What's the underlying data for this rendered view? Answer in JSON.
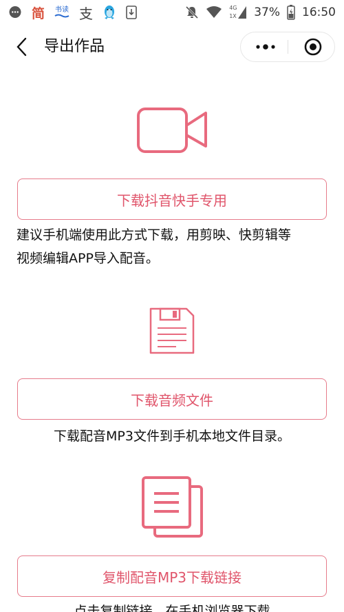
{
  "statusbar": {
    "left_icons": [
      "chat-bubble-icon",
      "jian-app-icon",
      "reader-app-icon",
      "alipay-icon",
      "qq-penguin-icon",
      "download-icon"
    ],
    "jian_glyph": "简",
    "reader_glyph": "书读",
    "alipay_glyph": "支",
    "network_label_top": "4G",
    "network_label_bottom": "1X",
    "battery": "37%",
    "time": "16:50"
  },
  "header": {
    "title": "导出作品"
  },
  "sections": [
    {
      "icon": "video-camera-icon",
      "button_label": "下载抖音快手专用",
      "description_lines": [
        "建议手机端使用此方式下载，用剪映、快剪辑等",
        "视频编辑APP导入配音。"
      ]
    },
    {
      "icon": "floppy-disk-icon",
      "button_label": "下载音频文件",
      "description": "下载配音MP3文件到手机本地文件目录。"
    },
    {
      "icon": "copy-document-icon",
      "button_label": "复制配音MP3下载链接",
      "description": "点击复制链接，在手机浏览器下载"
    }
  ],
  "colors": {
    "accent": "#e0556b",
    "icon_stroke": "#e86a7e",
    "border": "#e67a8a"
  }
}
